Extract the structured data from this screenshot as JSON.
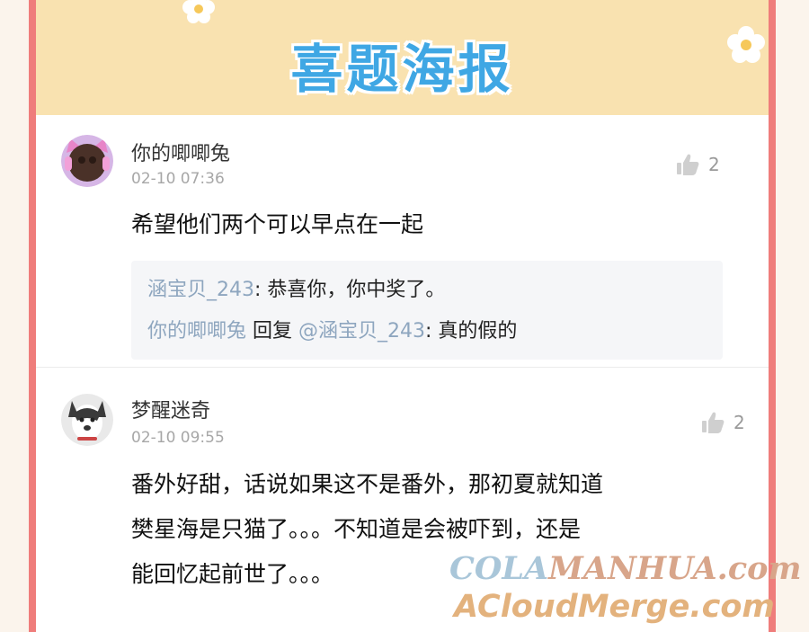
{
  "banner": {
    "title": "喜题海报"
  },
  "comments": [
    {
      "username": "你的唧唧兔",
      "timestamp": "02-10 07:36",
      "like_count": "2",
      "body_lines": [
        "希望他们两个可以早点在一起"
      ],
      "replies": [
        {
          "author": "涵宝贝_243",
          "text": ": 恭喜你，你中奖了。"
        },
        {
          "author": "你的唧唧兔",
          "action": "回复",
          "target": "@涵宝贝_243",
          "text": ": 真的假的"
        }
      ]
    },
    {
      "username": "梦醒迷奇",
      "timestamp": "02-10 09:55",
      "like_count": "2",
      "body_lines": [
        "番外好甜，话说如果这不是番外，那初夏就知道",
        "樊星海是只猫了。。。不知道是会被吓到，还是",
        "能回忆起前世了。。。"
      ]
    }
  ],
  "watermark": {
    "line1_a": "COLA",
    "line1_b": "MANHUA.com",
    "line2": "ACloudMerge.com"
  },
  "colors": {
    "frame": "#ef7d7b",
    "banner_bg": "#f9e2b0",
    "title": "#3fa7e4",
    "reply_name": "#8ea6bf"
  },
  "icons": {
    "like": "thumbs-up-icon",
    "flower": "flower-icon"
  }
}
